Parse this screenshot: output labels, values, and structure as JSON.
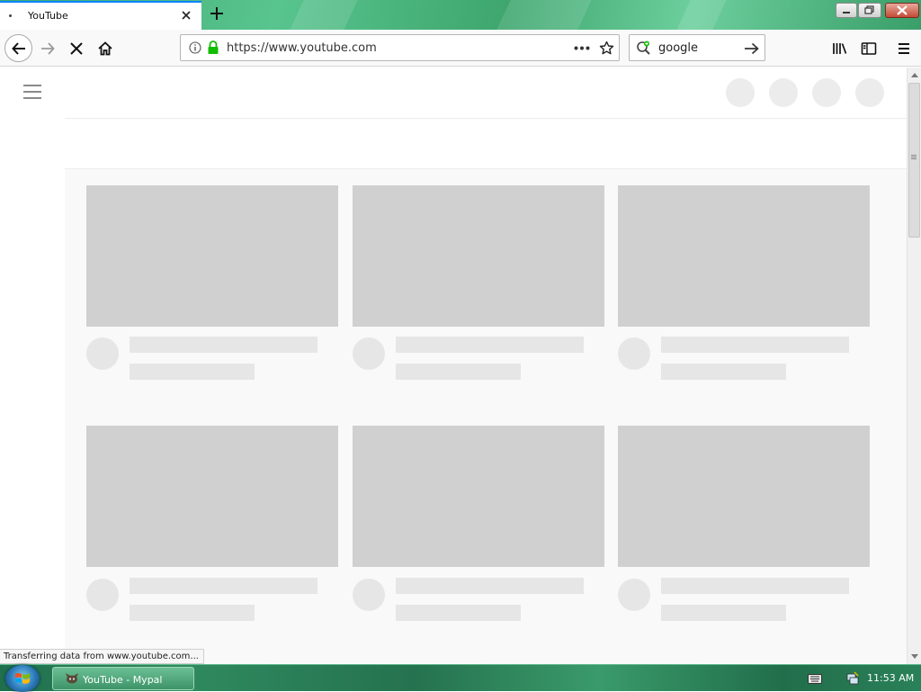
{
  "browser": {
    "tab_title": "YouTube",
    "url": "https://www.youtube.com",
    "search_query": "google"
  },
  "status_text": "Transferring data from www.youtube.com...",
  "taskbar": {
    "task_label": "YouTube - Mypal",
    "clock": "11:53 AM"
  },
  "colors": {
    "accent_blue": "#0a84ff",
    "lock_green": "#12bc00",
    "placeholder_thumb": "#d0d0d0",
    "placeholder_line": "#e6e6e6"
  },
  "icons": [
    "close-icon",
    "new-tab-icon",
    "back-icon",
    "forward-icon",
    "stop-icon",
    "home-icon",
    "info-icon",
    "lock-icon",
    "page-actions-icon",
    "bookmark-star-icon",
    "search-engine-icon",
    "go-arrow-icon",
    "library-icon",
    "sidebar-icon",
    "menu-icon",
    "hamburger-icon",
    "keyboard-icon",
    "network-icon",
    "windows-logo-icon"
  ]
}
